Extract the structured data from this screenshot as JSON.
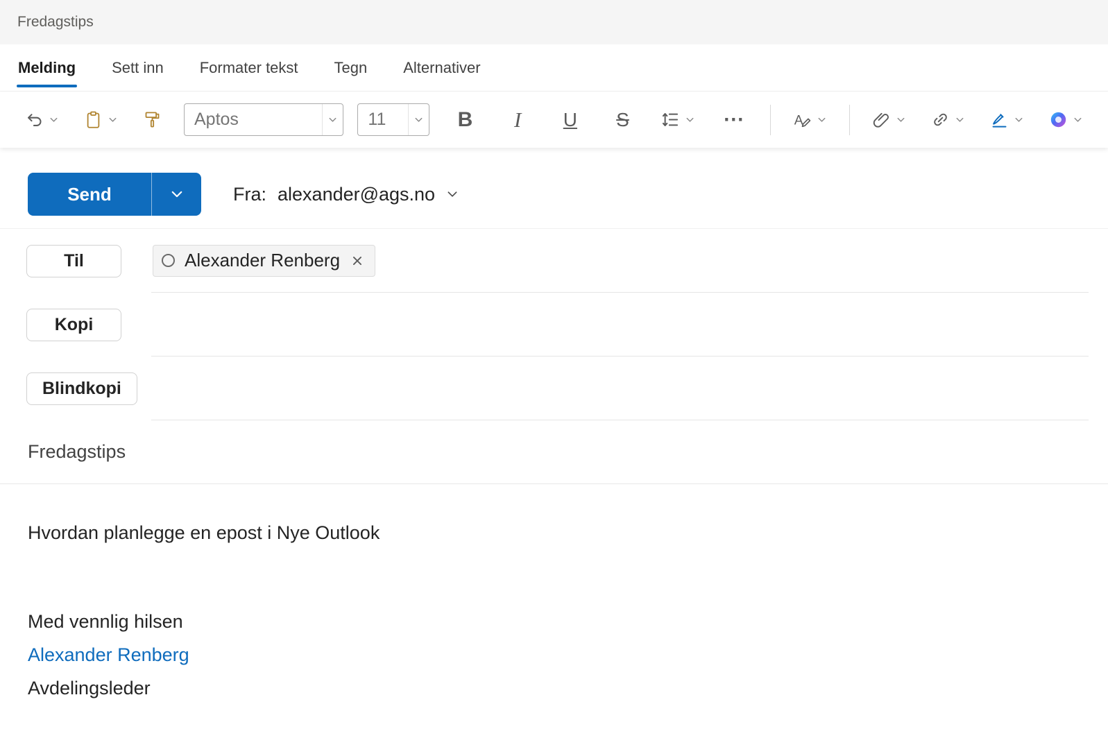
{
  "window": {
    "title": "Fredagstips"
  },
  "ribbon": {
    "tabs": [
      {
        "label": "Melding",
        "active": true
      },
      {
        "label": "Sett inn",
        "active": false
      },
      {
        "label": "Formater tekst",
        "active": false
      },
      {
        "label": "Tegn",
        "active": false
      },
      {
        "label": "Alternativer",
        "active": false
      }
    ]
  },
  "toolbar": {
    "font_name": "Aptos",
    "font_size": "11",
    "bold": "B",
    "italic": "I",
    "underline": "U",
    "strikethrough": "S",
    "more": "⋯"
  },
  "compose": {
    "send": "Send",
    "from_label": "Fra:",
    "from_address": "alexander@ags.no",
    "to_label": "Til",
    "cc_label": "Kopi",
    "bcc_label": "Blindkopi",
    "recipients": [
      {
        "name": "Alexander Renberg"
      }
    ],
    "subject": "Fredagstips",
    "body": [
      "Hvordan planlegge en epost i Nye Outlook"
    ],
    "signature": {
      "greeting": "Med vennlig hilsen",
      "name": "Alexander Renberg",
      "role": "Avdelingsleder"
    }
  },
  "colors": {
    "accent": "#0f6cbd",
    "link": "#0f6cbd",
    "clipboard_gold": "#b08430"
  }
}
